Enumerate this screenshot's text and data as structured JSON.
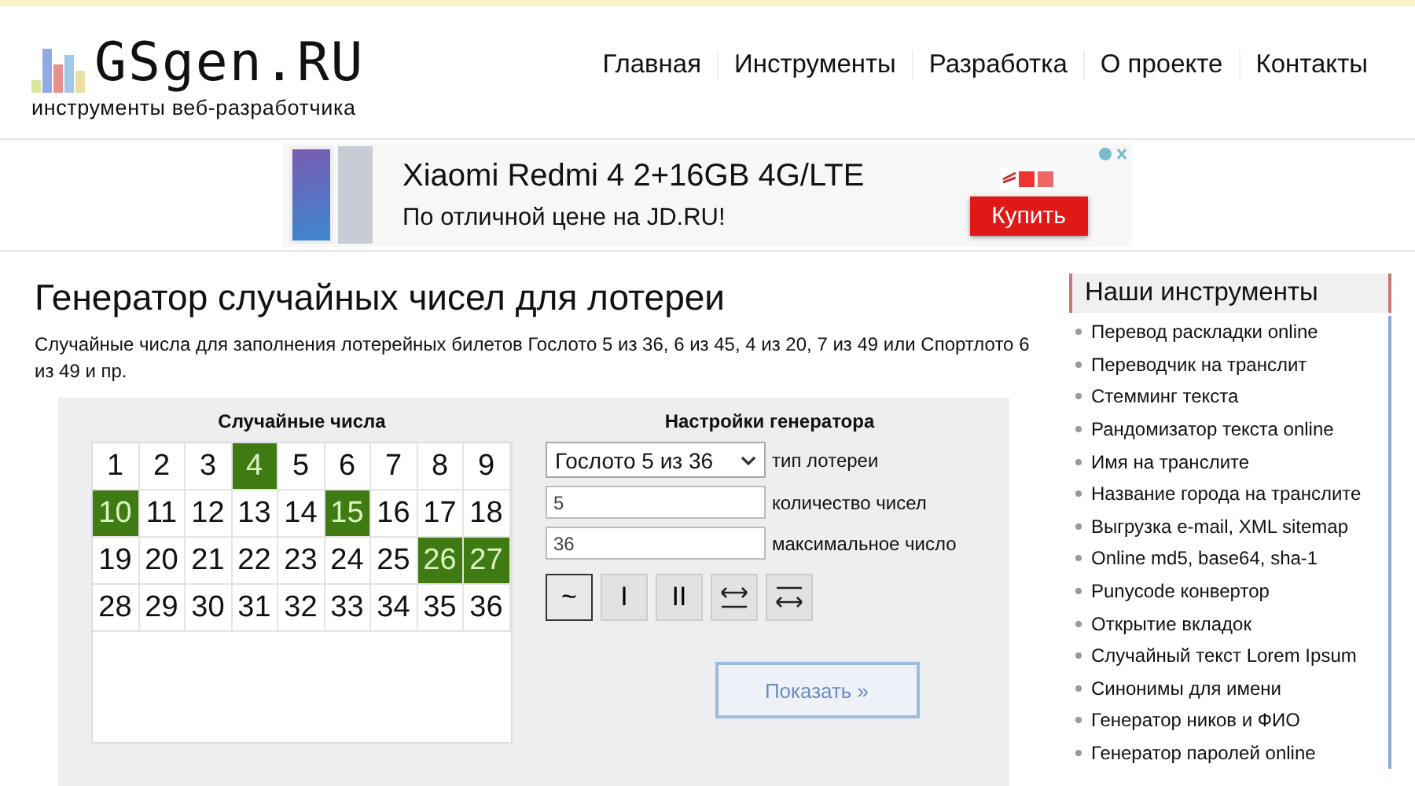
{
  "header": {
    "logo": "GSgen.RU",
    "tagline": "инструменты веб-разработчика",
    "nav": [
      "Главная",
      "Инструменты",
      "Разработка",
      "О проекте",
      "Контакты"
    ]
  },
  "ad": {
    "title": "Xiaomi Redmi 4 2+16GB 4G/LTE",
    "subtitle": "По отличной цене на JD.RU!",
    "button": "Купить"
  },
  "page": {
    "title": "Генератор случайных чисел для лотереи",
    "description": "Случайные числа для заполнения лотерейных билетов Гослото 5 из 36, 6 из 45, 4 из 20, 7 из 49 или Спортлото 6 из 49 и пр."
  },
  "numbers": {
    "heading": "Случайные числа",
    "cells": [
      {
        "label": "1",
        "selected": false
      },
      {
        "label": "2",
        "selected": false
      },
      {
        "label": "3",
        "selected": false
      },
      {
        "label": "4",
        "selected": true
      },
      {
        "label": "5",
        "selected": false
      },
      {
        "label": "6",
        "selected": false
      },
      {
        "label": "7",
        "selected": false
      },
      {
        "label": "8",
        "selected": false
      },
      {
        "label": "9",
        "selected": false
      },
      {
        "label": "10",
        "selected": true
      },
      {
        "label": "11",
        "selected": false
      },
      {
        "label": "12",
        "selected": false
      },
      {
        "label": "13",
        "selected": false
      },
      {
        "label": "14",
        "selected": false
      },
      {
        "label": "15",
        "selected": true
      },
      {
        "label": "16",
        "selected": false
      },
      {
        "label": "17",
        "selected": false
      },
      {
        "label": "18",
        "selected": false
      },
      {
        "label": "19",
        "selected": false
      },
      {
        "label": "20",
        "selected": false
      },
      {
        "label": "21",
        "selected": false
      },
      {
        "label": "22",
        "selected": false
      },
      {
        "label": "23",
        "selected": false
      },
      {
        "label": "24",
        "selected": false
      },
      {
        "label": "25",
        "selected": false
      },
      {
        "label": "26",
        "selected": true
      },
      {
        "label": "27",
        "selected": true
      },
      {
        "label": "28",
        "selected": false
      },
      {
        "label": "29",
        "selected": false
      },
      {
        "label": "30",
        "selected": false
      },
      {
        "label": "31",
        "selected": false
      },
      {
        "label": "32",
        "selected": false
      },
      {
        "label": "33",
        "selected": false
      },
      {
        "label": "34",
        "selected": false
      },
      {
        "label": "35",
        "selected": false
      },
      {
        "label": "36",
        "selected": false
      }
    ]
  },
  "settings": {
    "heading": "Настройки генератора",
    "fields": [
      {
        "kind": "select",
        "value": "Гослото 5 из 36",
        "label": "тип лотереи"
      },
      {
        "kind": "input",
        "value": "5",
        "label": "количество чисел"
      },
      {
        "kind": "input",
        "value": "36",
        "label": "максимальное число"
      }
    ],
    "modes": [
      {
        "kind": "text",
        "label": "~",
        "selected": true
      },
      {
        "kind": "text",
        "label": "I",
        "selected": false
      },
      {
        "kind": "text",
        "label": "II",
        "selected": false
      },
      {
        "kind": "arrow-over-line",
        "selected": false
      },
      {
        "kind": "line-over-arrow",
        "selected": false
      }
    ],
    "submit": "Показать »"
  },
  "sidebar": {
    "title": "Наши инструменты",
    "items": [
      "Перевод раскладки online",
      "Переводчик на транслит",
      "Стемминг текста",
      "Рандомизатор текста online",
      "Имя на транслите",
      "Название города на транслите",
      "Выгрузка e-mail, XML sitemap",
      "Online md5, base64, sha-1",
      "Punycode конвертор",
      "Открытие вкладок",
      "Случайный текст Lorem Ipsum",
      "Синонимы для имени",
      "Генератор ников и ФИО",
      "Генератор паролей online"
    ]
  }
}
